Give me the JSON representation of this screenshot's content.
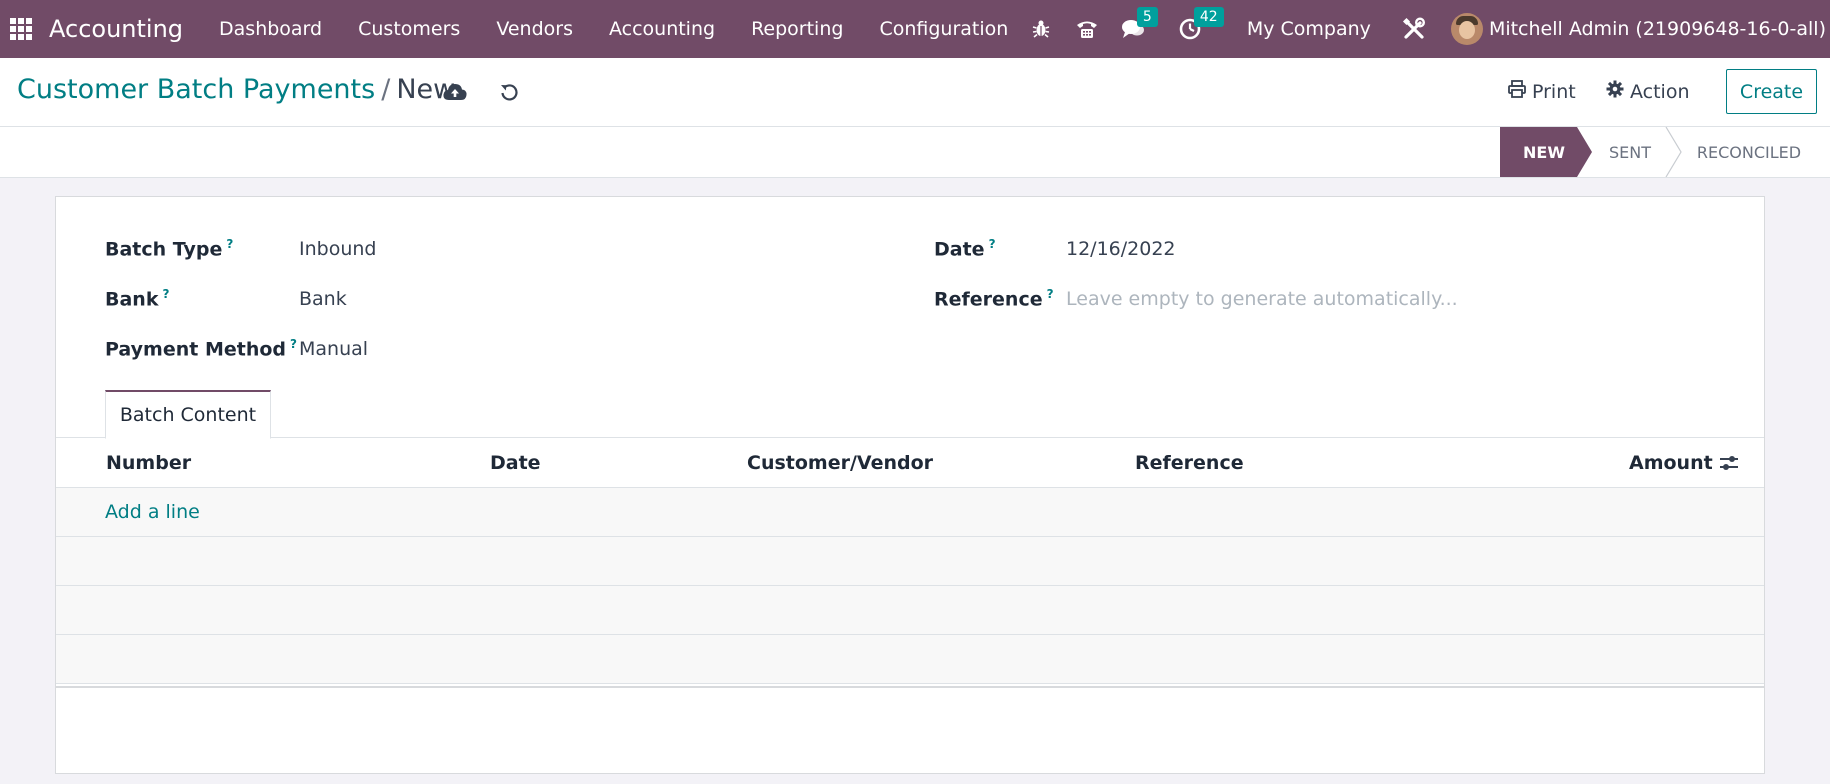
{
  "navbar": {
    "app_name": "Accounting",
    "menu": [
      "Dashboard",
      "Customers",
      "Vendors",
      "Accounting",
      "Reporting",
      "Configuration"
    ],
    "messages_count": "5",
    "activities_count": "42",
    "company": "My Company",
    "user": "Mitchell Admin (21909648-16-0-all)"
  },
  "control": {
    "breadcrumb_parent": "Customer Batch Payments",
    "breadcrumb_sep": "/",
    "breadcrumb_current": "New",
    "print_label": "Print",
    "action_label": "Action",
    "create_label": "Create"
  },
  "status": {
    "stages": [
      "NEW",
      "SENT",
      "RECONCILED"
    ],
    "active_stage": "NEW",
    "active_color": "#714b67"
  },
  "form": {
    "batch_type_label": "Batch Type",
    "batch_type_value": "Inbound",
    "bank_label": "Bank",
    "bank_value": "Bank",
    "payment_method_label": "Payment Method",
    "payment_method_value": "Manual",
    "date_label": "Date",
    "date_value": "12/16/2022",
    "reference_label": "Reference",
    "reference_placeholder": "Leave empty to generate automatically...",
    "help_mark": "?"
  },
  "tabs": {
    "batch_content": "Batch Content"
  },
  "table": {
    "columns": [
      "Number",
      "Date",
      "Customer/Vendor",
      "Reference",
      "Amount"
    ],
    "add_line": "Add a line"
  },
  "colors": {
    "brand": "#714b67",
    "accent": "#017e84",
    "badge": "#00a09d"
  }
}
